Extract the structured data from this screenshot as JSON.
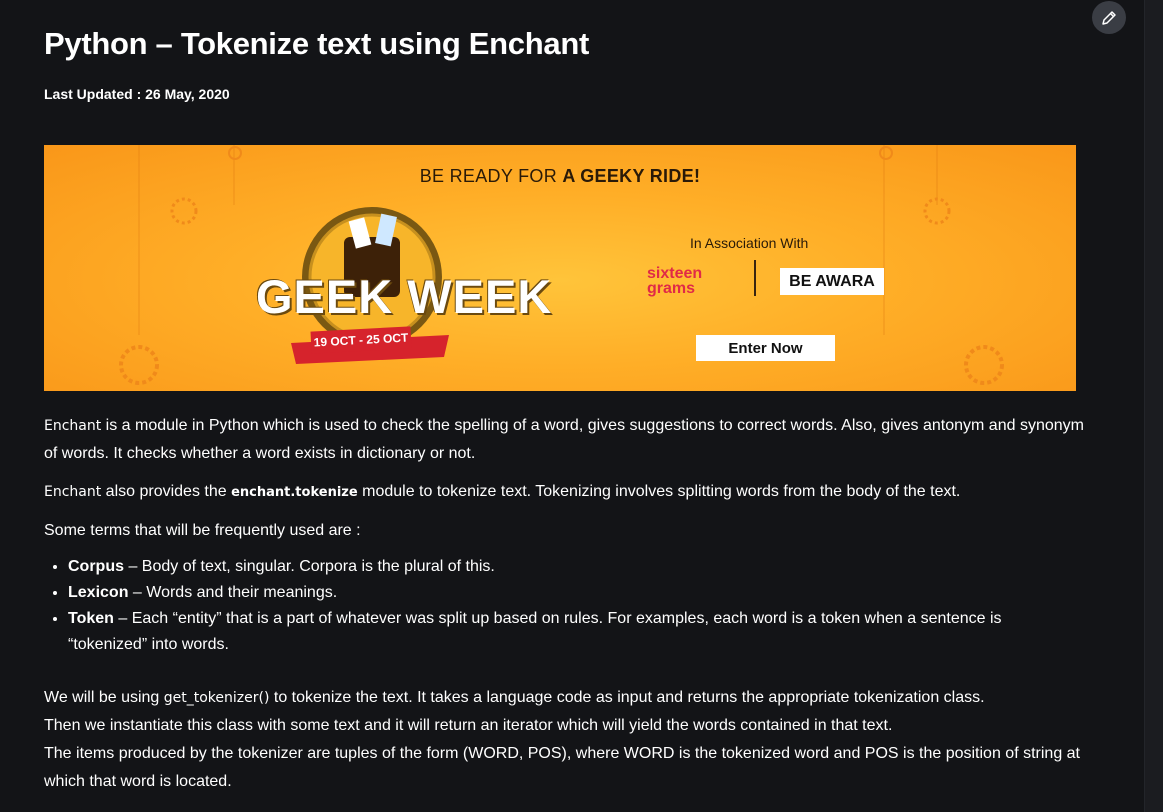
{
  "article": {
    "title": "Python – Tokenize text using Enchant",
    "last_updated": "Last Updated : 26 May, 2020"
  },
  "banner": {
    "tagline_normal": "BE READY FOR ",
    "tagline_bold": "A GEEKY RIDE!",
    "geek_week_title": "GEEK WEEK",
    "date_range": "19 OCT - 25 OCT",
    "association_label": "In Association With",
    "sponsor1": "sixteen grams",
    "sponsor2": "BE AWARA",
    "enter_button": "Enter Now",
    "background_color": "#ffae27"
  },
  "content": {
    "p1": {
      "code": "Enchant",
      "text": " is a module in Python which is used to check the spelling of a word, gives suggestions to correct words. Also, gives antonym and synonym of words. It checks whether a word exists in dictionary or not."
    },
    "p2": {
      "code": "Enchant",
      "text_a": " also provides the ",
      "code_bold": "enchant.tokenize",
      "text_b": " module to tokenize text. Tokenizing involves splitting words from the body of the text."
    },
    "p3": "Some terms that will be frequently used are :",
    "terms": [
      {
        "term": "Corpus",
        "definition": " – Body of text, singular. Corpora is the plural of this."
      },
      {
        "term": "Lexicon",
        "definition": " – Words and their meanings."
      },
      {
        "term": "Token",
        "definition": " – Each “entity” that is a part of whatever was split up based on rules. For examples, each word is a token when a sentence is “tokenized” into words."
      }
    ],
    "p4": {
      "text_a": "We will be using ",
      "code": "get_tokenizer()",
      "text_b": " to tokenize the text. It takes a language code as input and returns the appropriate tokenization class.",
      "line2": "Then we instantiate this class with some text and it will return an iterator which will yield the words contained in that text.",
      "line3": "The items produced by the tokenizer are tuples of the form (WORD, POS), where WORD is the tokenized word and POS is the position of string at which that word is located."
    }
  },
  "icons": {
    "edit": "pencil-icon"
  }
}
